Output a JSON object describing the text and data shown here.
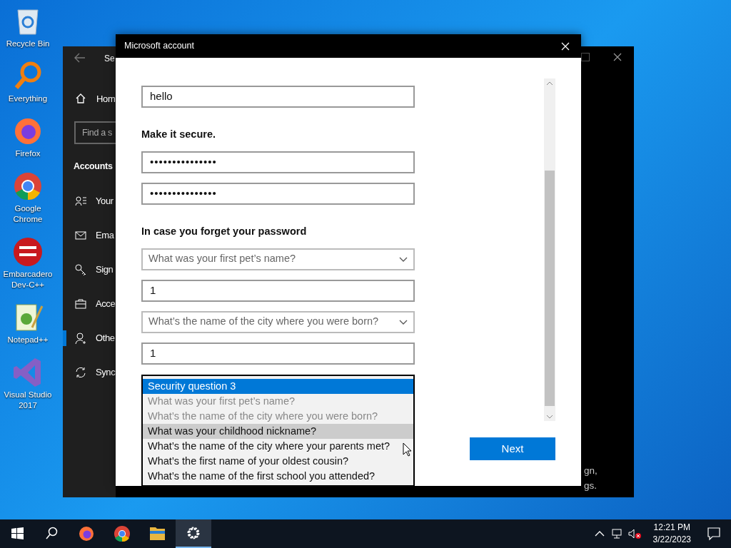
{
  "desktop_icons": [
    {
      "label": "Recycle Bin",
      "kind": "recycle"
    },
    {
      "label": "Everything",
      "kind": "everything"
    },
    {
      "label": "Firefox",
      "kind": "firefox"
    },
    {
      "label": "Google Chrome",
      "kind": "chrome"
    },
    {
      "label": "Embarcadero Dev-C++",
      "kind": "devcpp"
    },
    {
      "label": "Notepad++",
      "kind": "notepad"
    },
    {
      "label": "Visual Studio 2017",
      "kind": "vs"
    }
  ],
  "settings_window": {
    "title": "Se",
    "home": "Hom",
    "search_placeholder": "Find a s",
    "section": "Accounts",
    "nav_items": [
      {
        "label": "Your",
        "kind": "person",
        "selected": false
      },
      {
        "label": "Ema",
        "kind": "mail",
        "selected": false
      },
      {
        "label": "Sign",
        "kind": "key",
        "selected": false
      },
      {
        "label": "Acce",
        "kind": "briefcase",
        "selected": false
      },
      {
        "label": "Othe",
        "kind": "adduser",
        "selected": true
      },
      {
        "label": "Sync",
        "kind": "sync",
        "selected": false
      }
    ],
    "text_fragments": [
      "gn,",
      "gs."
    ]
  },
  "dialog": {
    "title": "Microsoft account",
    "fields": [
      {
        "kind": "text",
        "value": "hello"
      },
      {
        "kind": "heading",
        "label": "Make it secure."
      },
      {
        "kind": "password",
        "value": "•••••••••••••••"
      },
      {
        "kind": "password",
        "value": "•••••••••••••••"
      },
      {
        "kind": "heading",
        "label": "In case you forget your password"
      },
      {
        "kind": "select",
        "value": "What was your first pet’s name?"
      },
      {
        "kind": "text",
        "value": "1"
      },
      {
        "kind": "select",
        "value": "What’s the name of the city where you were born?"
      },
      {
        "kind": "text",
        "value": "1"
      }
    ],
    "dropdown": {
      "expanded": true,
      "options": [
        {
          "label": "Security question 3",
          "selected": true,
          "disabled": false,
          "hovered": false
        },
        {
          "label": "What was your first pet’s name?",
          "selected": false,
          "disabled": true,
          "hovered": false
        },
        {
          "label": "What’s the name of the city where you were born?",
          "selected": false,
          "disabled": true,
          "hovered": false
        },
        {
          "label": "What was your childhood nickname?",
          "selected": false,
          "disabled": false,
          "hovered": true
        },
        {
          "label": "What’s the name of the city where your parents met?",
          "selected": false,
          "disabled": false,
          "hovered": false
        },
        {
          "label": "What’s the first name of your oldest cousin?",
          "selected": false,
          "disabled": false,
          "hovered": false
        },
        {
          "label": "What’s the name of the first school you attended?",
          "selected": false,
          "disabled": false,
          "hovered": false
        }
      ]
    },
    "next_button": "Next"
  },
  "taskbar": {
    "apps": [
      {
        "kind": "firefox",
        "active": false
      },
      {
        "kind": "chrome",
        "active": false
      },
      {
        "kind": "explorer",
        "active": false
      },
      {
        "kind": "settings",
        "active": true
      }
    ],
    "time": "12:21 PM",
    "date": "3/22/2023"
  }
}
